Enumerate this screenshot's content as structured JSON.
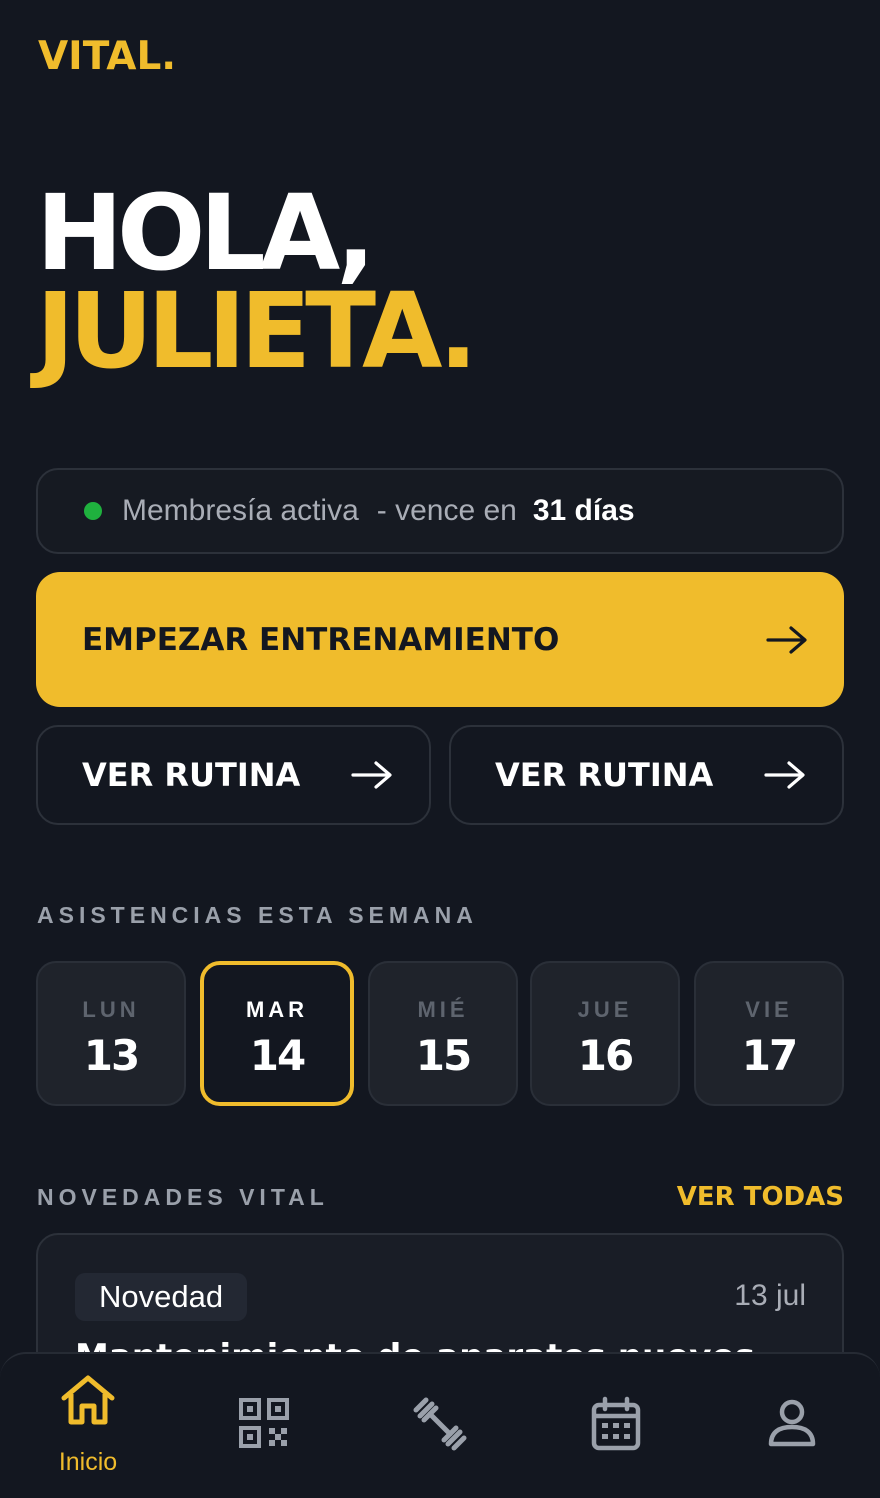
{
  "brand": {
    "logo": "VITAL."
  },
  "greeting": {
    "line1": "HOLA,",
    "line2": "JULIETA."
  },
  "membership": {
    "status": "Membresía activa",
    "separator": "- vence en",
    "remaining": "31 días",
    "status_color": "#1fb13e"
  },
  "actions": {
    "primary": "EMPEZAR ENTRENAMIENTO",
    "secondary_left": "VER RUTINA",
    "secondary_right": "VER RUTINA"
  },
  "attendance": {
    "title": "ASISTENCIAS ESTA SEMANA",
    "days": [
      {
        "name": "LUN",
        "number": "13",
        "active": false
      },
      {
        "name": "MAR",
        "number": "14",
        "active": true
      },
      {
        "name": "MIÉ",
        "number": "15",
        "active": false
      },
      {
        "name": "JUE",
        "number": "16",
        "active": false
      },
      {
        "name": "VIE",
        "number": "17",
        "active": false
      }
    ]
  },
  "news": {
    "title": "NOVEDADES VITAL",
    "see_all": "VER TODAS",
    "items": [
      {
        "tag": "Novedad",
        "date": "13 jul",
        "title": "Mantenimiento de aparatos nuevos"
      }
    ]
  },
  "nav": {
    "items": [
      {
        "icon": "home-icon",
        "label": "Inicio",
        "active": true
      },
      {
        "icon": "qr-code-icon",
        "label": "",
        "active": false
      },
      {
        "icon": "dumbbell-icon",
        "label": "",
        "active": false
      },
      {
        "icon": "calendar-icon",
        "label": "",
        "active": false
      },
      {
        "icon": "user-icon",
        "label": "",
        "active": false
      }
    ]
  },
  "colors": {
    "accent": "#F0BC2C",
    "background": "#131720",
    "card": "#1f232b",
    "muted": "#9aa0aa"
  }
}
